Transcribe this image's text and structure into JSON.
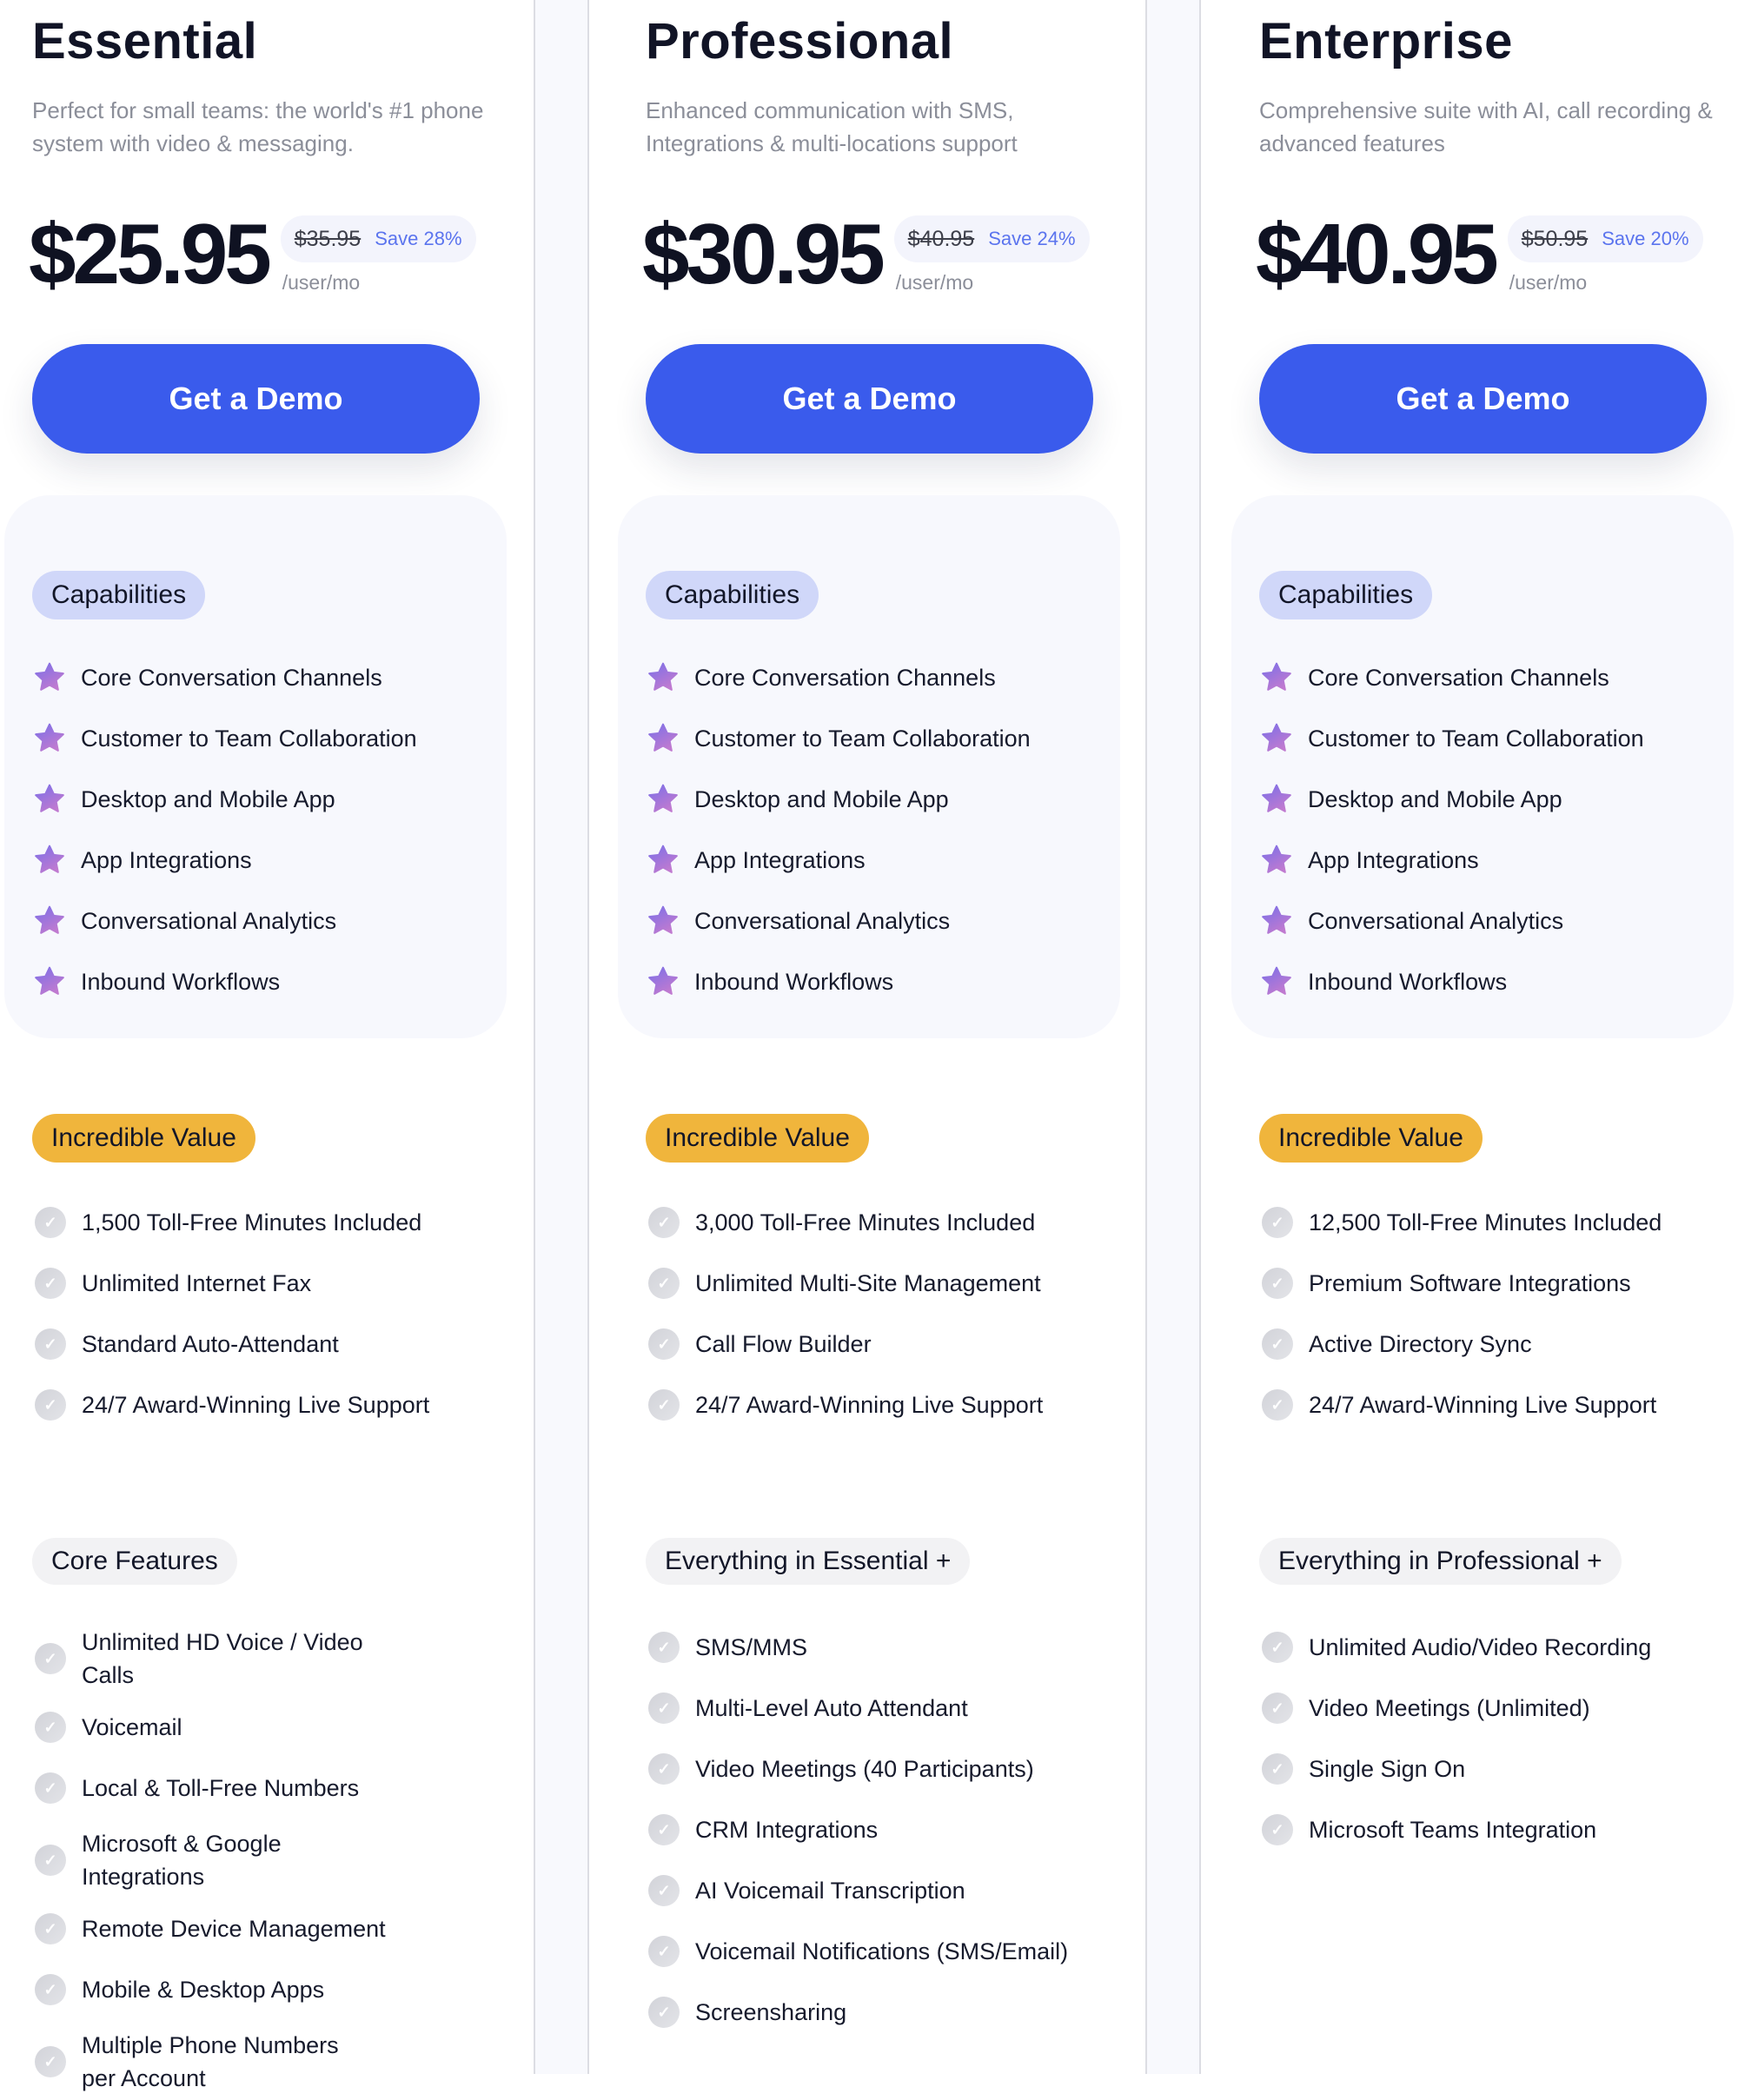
{
  "colors": {
    "accent": "#3a5bec",
    "save_text": "#5b74ee",
    "capabilities_pill": "#d0d7f9",
    "value_pill": "#f0b53c",
    "features_pill": "#f2f2f4",
    "star_gradient": [
      "#7b6fe8",
      "#c07ad0"
    ],
    "check_bg": "#d8d9de"
  },
  "plans": [
    {
      "title": "Essential",
      "description": "Perfect for small teams: the world's #1 phone system with video & messaging.",
      "price": "$25.95",
      "old_price": "$35.95",
      "save": "Save 28%",
      "per_unit": "/user/mo",
      "cta": "Get a Demo",
      "capabilities_label": "Capabilities",
      "capabilities": [
        "Core Conversation Channels",
        "Customer to Team Collaboration",
        "Desktop and Mobile App",
        "App Integrations",
        "Conversational Analytics",
        "Inbound Workflows"
      ],
      "value_label": "Incredible Value",
      "value_items": [
        "1,500 Toll-Free Minutes Included",
        "Unlimited Internet Fax",
        "Standard Auto-Attendant",
        "24/7 Award-Winning Live Support"
      ],
      "features_label": "Core Features",
      "features": [
        "Unlimited HD Voice / Video Calls",
        "Voicemail",
        "Local & Toll-Free Numbers",
        "Microsoft & Google Integrations",
        "Remote Device Management",
        "Mobile & Desktop Apps",
        "Multiple Phone Numbers per Account"
      ]
    },
    {
      "title": "Professional",
      "description": "Enhanced communication with SMS, Integrations & multi-locations support",
      "price": "$30.95",
      "old_price": "$40.95",
      "save": "Save 24%",
      "per_unit": "/user/mo",
      "cta": "Get a Demo",
      "capabilities_label": "Capabilities",
      "capabilities": [
        "Core Conversation Channels",
        "Customer to Team Collaboration",
        "Desktop and Mobile App",
        "App Integrations",
        "Conversational Analytics",
        "Inbound Workflows"
      ],
      "value_label": "Incredible Value",
      "value_items": [
        "3,000 Toll-Free Minutes Included",
        "Unlimited Multi-Site Management",
        "Call Flow Builder",
        "24/7 Award-Winning Live Support"
      ],
      "features_label": "Everything in Essential +",
      "features": [
        "SMS/MMS",
        "Multi-Level Auto Attendant",
        "Video Meetings (40 Participants)",
        "CRM Integrations",
        "AI Voicemail Transcription",
        "Voicemail Notifications (SMS/Email)",
        "Screensharing"
      ]
    },
    {
      "title": "Enterprise",
      "description": "Comprehensive suite with AI, call recording & advanced features",
      "price": "$40.95",
      "old_price": "$50.95",
      "save": "Save 20%",
      "per_unit": "/user/mo",
      "cta": "Get a Demo",
      "capabilities_label": "Capabilities",
      "capabilities": [
        "Core Conversation Channels",
        "Customer to Team Collaboration",
        "Desktop and Mobile App",
        "App Integrations",
        "Conversational Analytics",
        "Inbound Workflows"
      ],
      "value_label": "Incredible Value",
      "value_items": [
        "12,500 Toll-Free Minutes Included",
        "Premium Software Integrations",
        "Active Directory Sync",
        "24/7 Award-Winning Live Support"
      ],
      "features_label": "Everything in Professional +",
      "features": [
        "Unlimited Audio/Video Recording",
        "Video Meetings (Unlimited)",
        "Single Sign On",
        "Microsoft Teams Integration"
      ]
    }
  ],
  "icons": {
    "capability": "star-icon",
    "included": "check-circle-icon"
  }
}
